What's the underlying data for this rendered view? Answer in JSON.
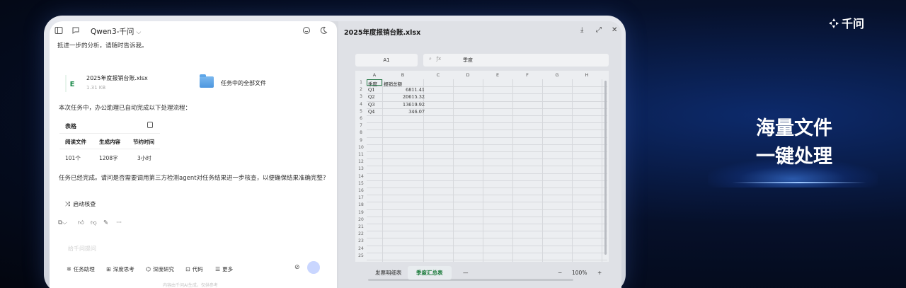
{
  "brand": {
    "name": "千问"
  },
  "headline": {
    "line1": "海量文件",
    "line2": "一键处理"
  },
  "chat": {
    "model": "Qwen3-千问",
    "intro": "抵进一步的分析，请随时告诉我。",
    "file": {
      "name": "2025年度报销台账.xlsx",
      "size": "1.31 KB"
    },
    "folder": {
      "name": "任务中的全部文件"
    },
    "summary": "本次任务中，办公助理已自动完成以下处理流程：",
    "table": {
      "title": "表格",
      "headers": [
        "阅读文件",
        "生成内容",
        "节约时间"
      ],
      "values": [
        "101个",
        "1208字",
        "3小时"
      ]
    },
    "question": "任务已经完成。请问是否需要调用第三方检测agent对任务结果进一步核查，以便确保结果准确完整?",
    "auto_verify": "启动核查",
    "input_placeholder": "给千问提问",
    "tools": [
      "任务助理",
      "深度思考",
      "深度研究",
      "代码",
      "更多"
    ],
    "disclaimer": "内容由千问AI生成，仅供参考"
  },
  "sheet": {
    "title": "2025年度报销台账.xlsx",
    "cell_ref": "A1",
    "formula_value": "季度",
    "columns": [
      "A",
      "B",
      "C",
      "D",
      "E",
      "F",
      "G",
      "H"
    ],
    "rows": [
      "1",
      "2",
      "3",
      "4",
      "5",
      "6",
      "7",
      "8",
      "9",
      "10",
      "11",
      "12",
      "13",
      "14",
      "15",
      "16",
      "17",
      "18",
      "19",
      "20",
      "21",
      "22",
      "23",
      "24",
      "25"
    ],
    "data": [
      [
        "季度",
        "报销总额"
      ],
      [
        "Q1",
        "6811.41"
      ],
      [
        "Q2",
        "20615.32"
      ],
      [
        "Q3",
        "13619.92"
      ],
      [
        "Q4",
        "346.07"
      ]
    ],
    "tabs": [
      "发票明细表",
      "季度汇总表"
    ],
    "active_tab": "季度汇总表",
    "zoom": "100%"
  }
}
